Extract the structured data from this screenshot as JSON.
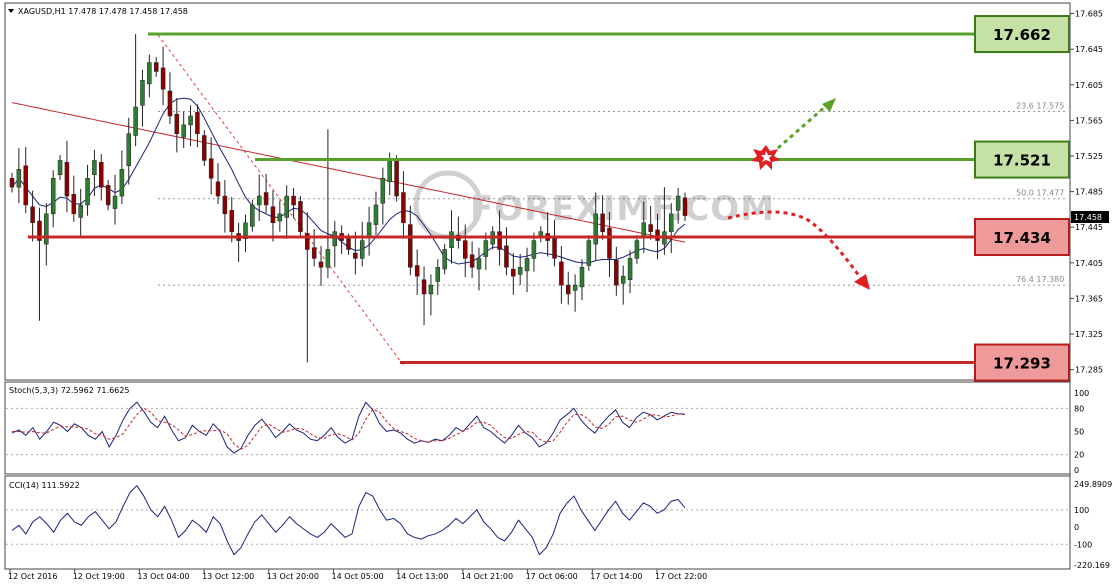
{
  "chart_data": {
    "type": "candlestick",
    "symbol_header": "XAGUSD,H1  17.478 17.478 17.458 17.458",
    "current_price": "17.458",
    "price_axis_ticks": [
      "17.685",
      "17.645",
      "17.605",
      "17.565",
      "17.525",
      "17.485",
      "17.445",
      "17.405",
      "17.365",
      "17.325",
      "17.285"
    ],
    "y_range": [
      17.279,
      17.689
    ],
    "time_ticks": [
      "12 Oct 2016",
      "12 Oct 19:00",
      "13 Oct 04:00",
      "13 Oct 12:00",
      "13 Oct 20:00",
      "14 Oct 05:00",
      "14 Oct 13:00",
      "14 Oct 21:00",
      "17 Oct 06:00",
      "17 Oct 14:00",
      "17 Oct 22:00"
    ],
    "levels": [
      {
        "label": "17.662",
        "value": 17.662,
        "kind": "resistance"
      },
      {
        "label": "17.521",
        "value": 17.521,
        "kind": "resistance"
      },
      {
        "label": "17.434",
        "value": 17.434,
        "kind": "support"
      },
      {
        "label": "17.293",
        "value": 17.293,
        "kind": "support"
      }
    ],
    "fibonacci": [
      {
        "label": "23.6  17.575",
        "value": 17.575
      },
      {
        "label": "50.0  17.477",
        "value": 17.477
      },
      {
        "label": "76.4  17.380",
        "value": 17.38
      }
    ],
    "candle_closes": [
      17.49,
      17.51,
      17.47,
      17.45,
      17.43,
      17.46,
      17.5,
      17.52,
      17.48,
      17.46,
      17.47,
      17.5,
      17.52,
      17.49,
      17.47,
      17.48,
      17.51,
      17.55,
      17.58,
      17.61,
      17.63,
      17.62,
      17.6,
      17.57,
      17.55,
      17.56,
      17.57,
      17.55,
      17.52,
      17.5,
      17.48,
      17.46,
      17.44,
      17.43,
      17.45,
      17.47,
      17.48,
      17.47,
      17.45,
      17.46,
      17.48,
      17.47,
      17.44,
      17.42,
      17.41,
      17.4,
      17.42,
      17.44,
      17.43,
      17.42,
      17.41,
      17.43,
      17.45,
      17.47,
      17.5,
      17.52,
      17.48,
      17.45,
      17.4,
      17.39,
      17.37,
      17.38,
      17.4,
      17.42,
      17.44,
      17.43,
      17.41,
      17.4,
      17.41,
      17.43,
      17.44,
      17.42,
      17.4,
      17.39,
      17.4,
      17.41,
      17.43,
      17.44,
      17.43,
      17.41,
      17.38,
      17.37,
      17.38,
      17.4,
      17.43,
      17.46,
      17.44,
      17.41,
      17.38,
      17.39,
      17.41,
      17.43,
      17.45,
      17.44,
      17.43,
      17.44,
      17.46,
      17.48,
      17.458
    ],
    "stochastic": {
      "label": "Stoch(5,3,3) 72.5962 71.6625",
      "ticks": [
        "100",
        "80",
        "50",
        "20",
        "0"
      ],
      "range": [
        0,
        100
      ],
      "main": [
        48,
        52,
        45,
        55,
        40,
        50,
        62,
        58,
        50,
        60,
        55,
        45,
        40,
        50,
        30,
        45,
        65,
        80,
        88,
        76,
        62,
        55,
        70,
        52,
        38,
        42,
        58,
        50,
        45,
        60,
        50,
        30,
        22,
        28,
        45,
        58,
        66,
        55,
        42,
        50,
        60,
        52,
        48,
        40,
        38,
        45,
        55,
        42,
        35,
        40,
        70,
        88,
        78,
        60,
        50,
        52,
        48,
        40,
        35,
        38,
        36,
        40,
        38,
        45,
        55,
        50,
        60,
        70,
        55,
        50,
        42,
        35,
        45,
        58,
        48,
        42,
        30,
        35,
        48,
        65,
        72,
        80,
        65,
        55,
        48,
        60,
        70,
        78,
        62,
        55,
        68,
        75,
        72,
        65,
        70,
        75,
        73,
        72.6
      ],
      "signal": [
        50,
        50,
        49,
        50,
        48,
        48,
        53,
        57,
        56,
        56,
        55,
        53,
        47,
        45,
        40,
        42,
        47,
        60,
        72,
        80,
        75,
        64,
        62,
        59,
        52,
        44,
        46,
        50,
        51,
        51,
        52,
        47,
        34,
        27,
        32,
        44,
        56,
        60,
        54,
        49,
        51,
        54,
        53,
        47,
        42,
        41,
        46,
        47,
        44,
        39,
        48,
        66,
        79,
        75,
        63,
        54,
        50,
        47,
        41,
        38,
        36,
        38,
        38,
        41,
        46,
        50,
        55,
        62,
        62,
        58,
        49,
        42,
        41,
        46,
        50,
        49,
        40,
        36,
        38,
        49,
        62,
        72,
        72,
        67,
        56,
        54,
        59,
        69,
        70,
        65,
        62,
        66,
        72,
        71,
        69,
        70,
        73,
        71.7
      ]
    },
    "cci": {
      "label": "CCI(14) 111.5922",
      "ticks": [
        "249.8909",
        "100",
        "0",
        "-100",
        "-220.169"
      ],
      "range": [
        -220.169,
        249.8909
      ],
      "values": [
        -20,
        10,
        -40,
        30,
        60,
        20,
        -30,
        40,
        80,
        30,
        10,
        60,
        90,
        40,
        -10,
        30,
        120,
        200,
        240,
        180,
        100,
        60,
        120,
        40,
        -60,
        -20,
        40,
        10,
        -30,
        60,
        20,
        -80,
        -160,
        -120,
        -40,
        30,
        70,
        20,
        -30,
        10,
        60,
        20,
        -10,
        -40,
        -60,
        -30,
        20,
        -20,
        -60,
        -40,
        120,
        200,
        180,
        100,
        40,
        50,
        20,
        -40,
        -60,
        -70,
        -50,
        -40,
        -20,
        10,
        50,
        20,
        60,
        100,
        30,
        -10,
        -60,
        -80,
        -30,
        40,
        -10,
        -60,
        -160,
        -120,
        -40,
        80,
        140,
        180,
        100,
        40,
        -20,
        40,
        100,
        150,
        80,
        40,
        90,
        140,
        120,
        80,
        100,
        150,
        160,
        111.6
      ]
    }
  }
}
